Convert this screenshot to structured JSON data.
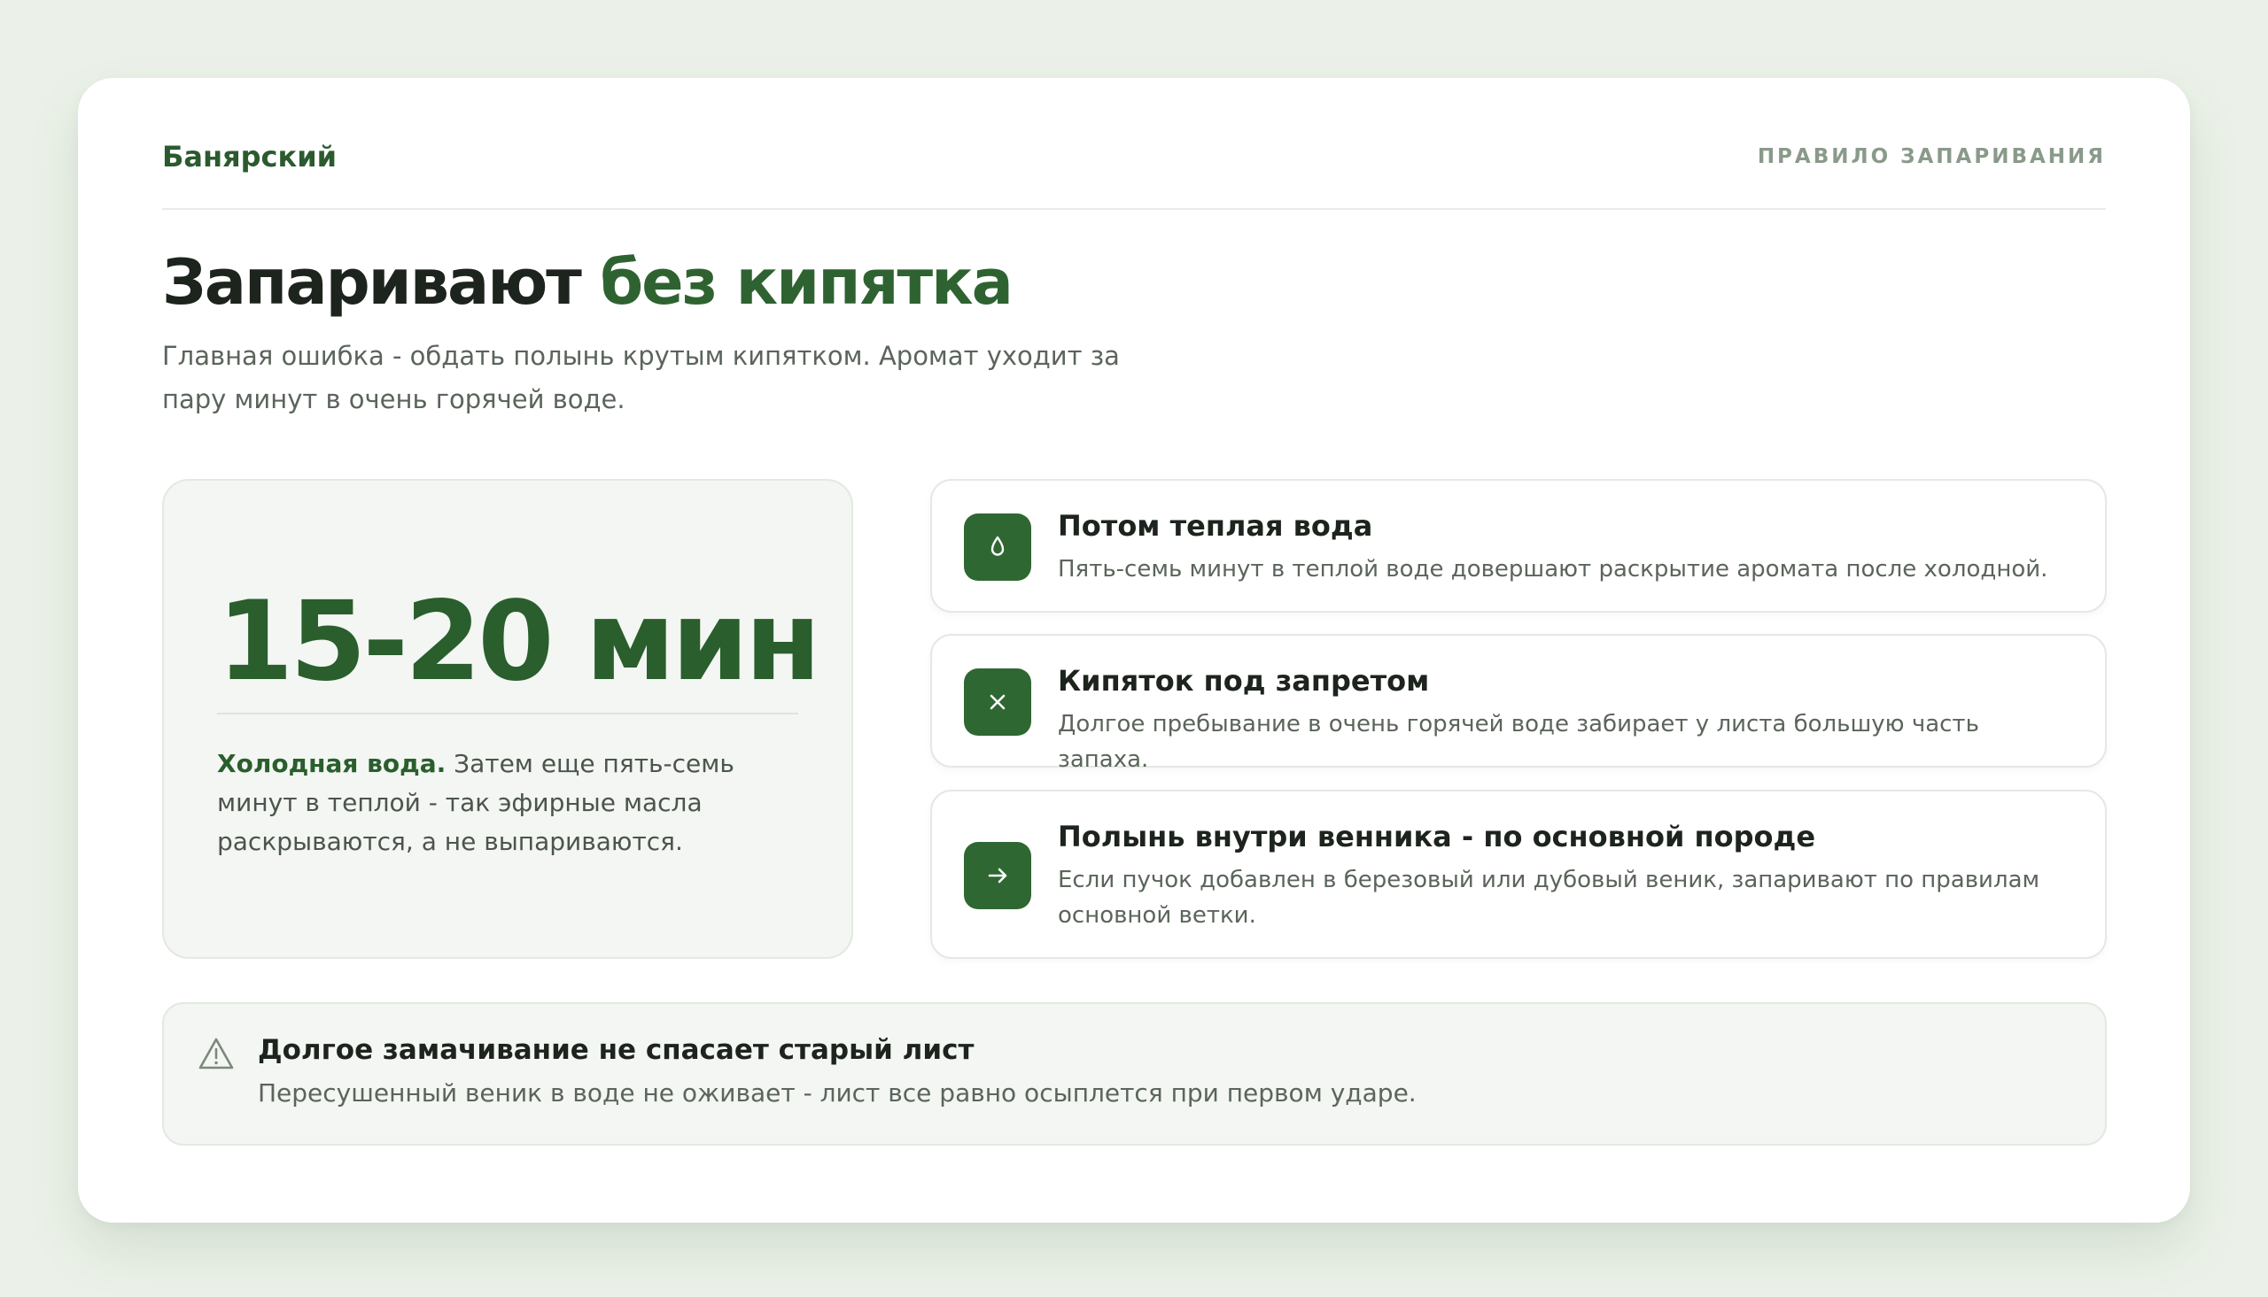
{
  "header": {
    "brand": "Банярский",
    "label": "ПРАВИЛО ЗАПАРИВАНИЯ"
  },
  "hero": {
    "title_main": "Запаривают",
    "title_accent": "без кипятка",
    "subtitle": "Главная ошибка - обдать полынь крутым кипятком. Аромат уходит за пару минут в очень горячей воде."
  },
  "time_card": {
    "value": "15-20 мин",
    "desc_strong": "Холодная вода.",
    "desc_rest": "Затем еще пять-семь минут в теплой - так эфирные масла раскрываются, а не выпариваются."
  },
  "items": [
    {
      "icon": "water-drop-icon",
      "title": "Потом теплая вода",
      "desc": "Пять-семь минут в теплой воде довершают раскрытие аромата после холодной."
    },
    {
      "icon": "close-icon",
      "title": "Кипяток под запретом",
      "desc": "Долгое пребывание в очень горячей воде забирает у листа большую часть запаха."
    },
    {
      "icon": "arrow-right-icon",
      "title": "Полынь внутри венника - по основной породе",
      "desc": "Если пучок добавлен в березовый или дубовый веник, запаривают по правилам основной ветки."
    }
  ],
  "warning": {
    "icon": "warning-triangle-icon",
    "title": "Долгое замачивание не спасает старый лист",
    "desc": "Пересушенный веник в воде не оживает - лист все равно осыплется при первом ударе."
  },
  "colors": {
    "accent": "#2e6331",
    "page_bg": "#ebf1e8",
    "card_bg": "#ffffff",
    "panel_bg": "#f3f6f2"
  }
}
